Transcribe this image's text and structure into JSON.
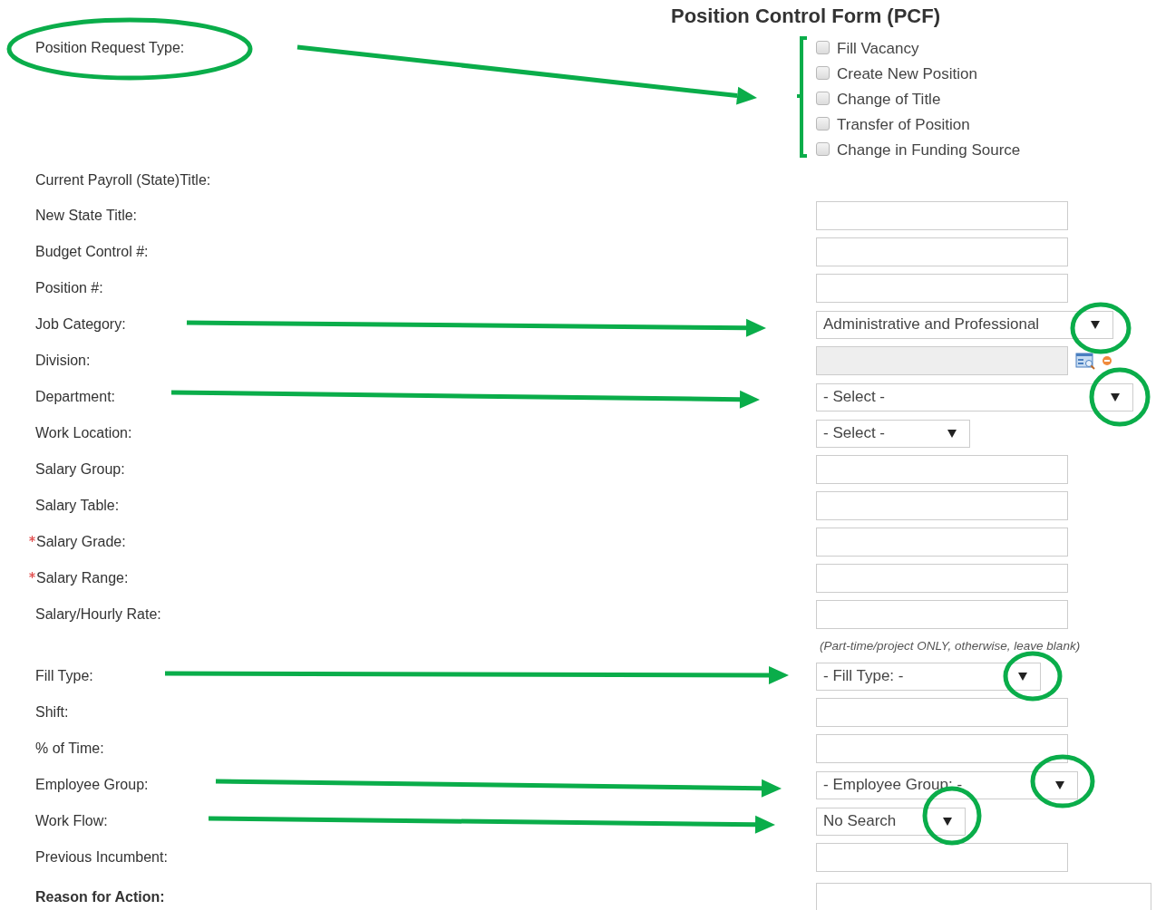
{
  "title": "Position Control Form (PCF)",
  "request_type": {
    "label": "Position Request Type:",
    "options": [
      {
        "label": "Fill Vacancy",
        "checked": false
      },
      {
        "label": "Create New Position",
        "checked": false
      },
      {
        "label": "Change of Title",
        "checked": false
      },
      {
        "label": "Transfer of Position",
        "checked": false
      },
      {
        "label": "Change in Funding Source",
        "checked": false
      }
    ]
  },
  "fields": [
    {
      "label": "Current Payroll (State)Title:",
      "kind": "none",
      "required": false
    },
    {
      "label": "New State Title:",
      "kind": "text",
      "required": false
    },
    {
      "label": "Budget Control #:",
      "kind": "text",
      "required": false
    },
    {
      "label": "Position #:",
      "kind": "text",
      "required": false
    },
    {
      "label": "Job Category:",
      "kind": "select",
      "value": "Administrative and Professional",
      "required": false
    },
    {
      "label": "Division:",
      "kind": "lookup",
      "required": false
    },
    {
      "label": "Department:",
      "kind": "select",
      "value": "- Select -",
      "required": false
    },
    {
      "label": "Work Location:",
      "kind": "select",
      "value": "- Select -",
      "required": false
    },
    {
      "label": "Salary Group:",
      "kind": "text",
      "required": false
    },
    {
      "label": "Salary Table:",
      "kind": "text",
      "required": false
    },
    {
      "label": "Salary Grade:",
      "kind": "text",
      "required": true
    },
    {
      "label": "Salary Range:",
      "kind": "text",
      "required": true
    },
    {
      "label": "Salary/Hourly Rate:",
      "kind": "text",
      "required": false,
      "hint": "(Part-time/project ONLY, otherwise, leave blank)"
    },
    {
      "label": "Fill Type:",
      "kind": "select",
      "value": "- Fill Type: -",
      "required": false
    },
    {
      "label": "Shift:",
      "kind": "text",
      "required": false
    },
    {
      "label": "% of Time:",
      "kind": "text",
      "required": false
    },
    {
      "label": "Employee Group:",
      "kind": "select",
      "value": "- Employee Group: -",
      "required": false
    },
    {
      "label": "Work Flow:",
      "kind": "select",
      "value": "No Search",
      "required": false
    },
    {
      "label": "Previous Incumbent:",
      "kind": "text",
      "required": false
    },
    {
      "label": "Reason for Action:",
      "kind": "textarea",
      "required": false
    }
  ]
}
